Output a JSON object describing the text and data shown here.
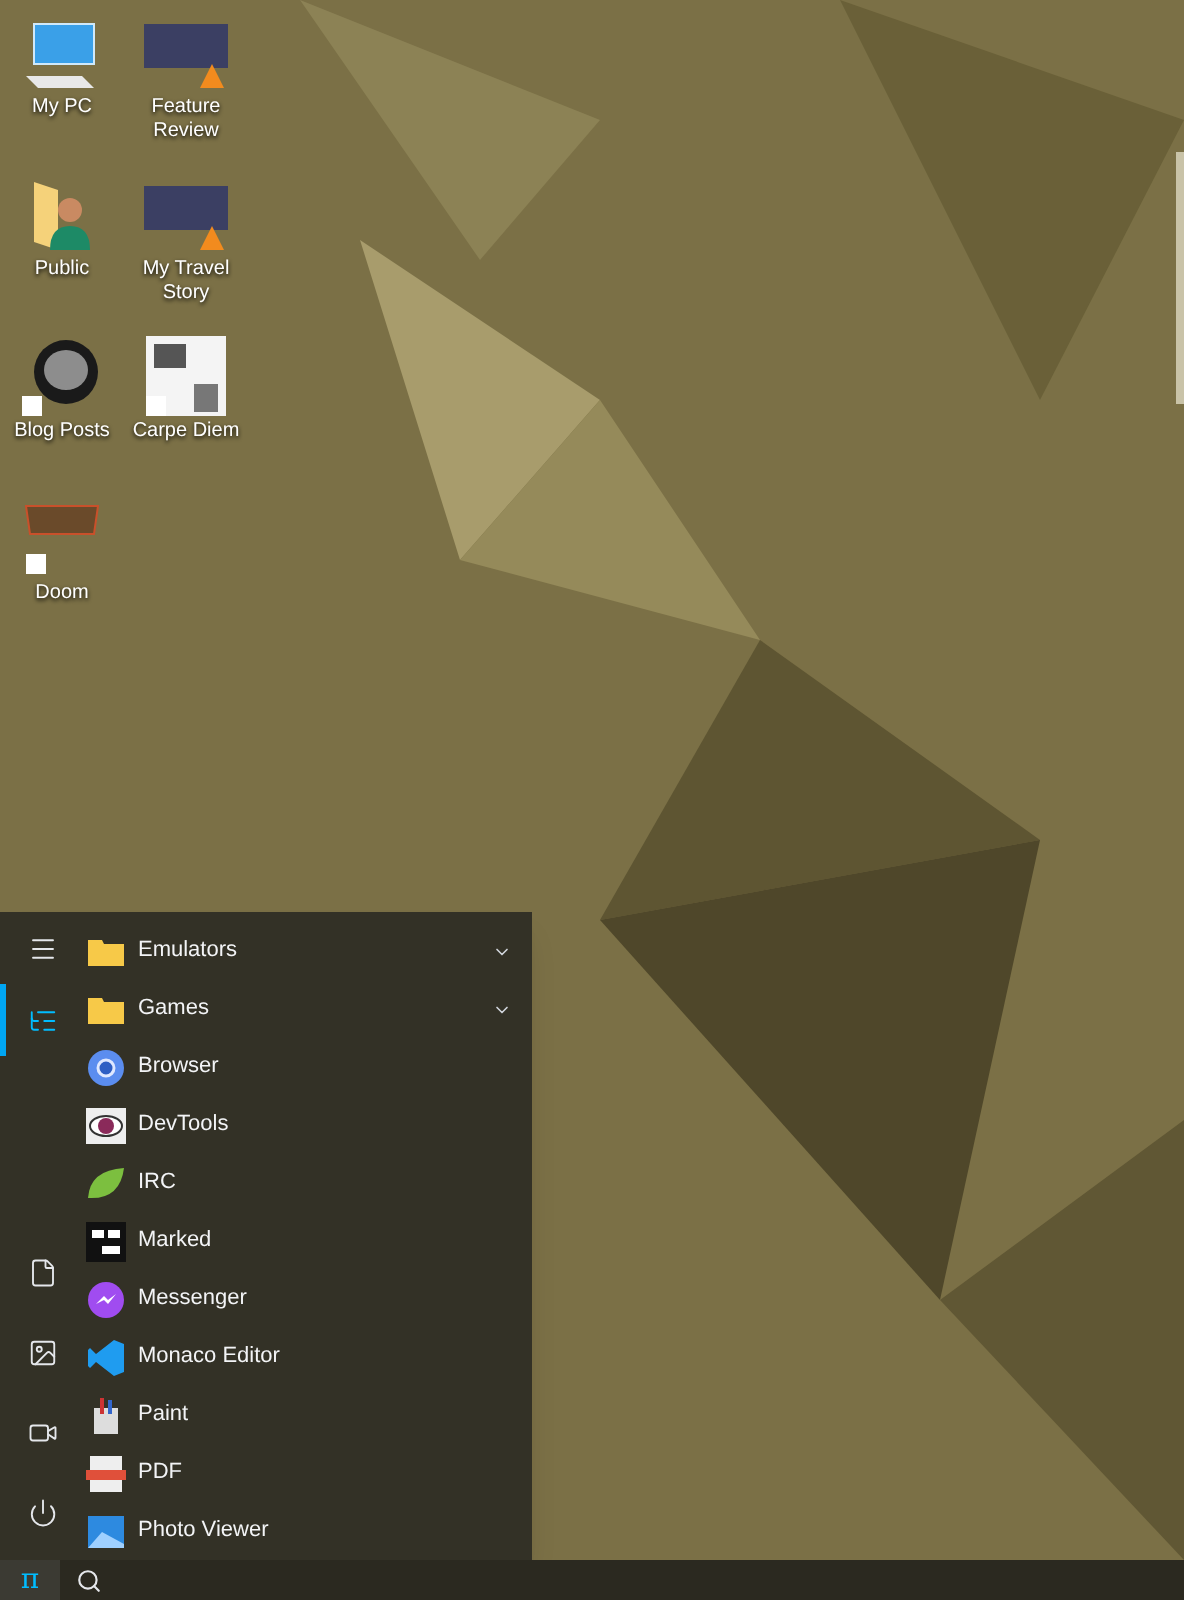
{
  "desktop_icons": [
    {
      "label": "My PC",
      "kind": "computer"
    },
    {
      "label": "Feature Review",
      "kind": "video"
    },
    {
      "label": "Public",
      "kind": "user-folder"
    },
    {
      "label": "My Travel Story",
      "kind": "video"
    },
    {
      "label": "Blog Posts",
      "kind": "shortcut-photo"
    },
    {
      "label": "Carpe Diem",
      "kind": "shortcut-document"
    },
    {
      "label": "Doom",
      "kind": "shortcut-game"
    }
  ],
  "start_menu": {
    "rail_top": [
      {
        "kind": "menu",
        "selected": false
      },
      {
        "kind": "list",
        "selected": true
      }
    ],
    "rail_bottom": [
      {
        "kind": "document",
        "selected": false
      },
      {
        "kind": "image",
        "selected": false
      },
      {
        "kind": "video",
        "selected": false
      },
      {
        "kind": "power",
        "selected": false
      }
    ],
    "apps": [
      {
        "label": "Emulators",
        "kind": "folder",
        "expanded": false
      },
      {
        "label": "Games",
        "kind": "folder",
        "expanded": false
      },
      {
        "label": "Browser",
        "kind": "browser"
      },
      {
        "label": "DevTools",
        "kind": "eye"
      },
      {
        "label": "IRC",
        "kind": "leaf"
      },
      {
        "label": "Marked",
        "kind": "markdown"
      },
      {
        "label": "Messenger",
        "kind": "messenger"
      },
      {
        "label": "Monaco Editor",
        "kind": "code"
      },
      {
        "label": "Paint",
        "kind": "paint"
      },
      {
        "label": "PDF",
        "kind": "pdf"
      },
      {
        "label": "Photo Viewer",
        "kind": "photo"
      }
    ]
  },
  "taskbar": {
    "start_symbol": "π"
  }
}
